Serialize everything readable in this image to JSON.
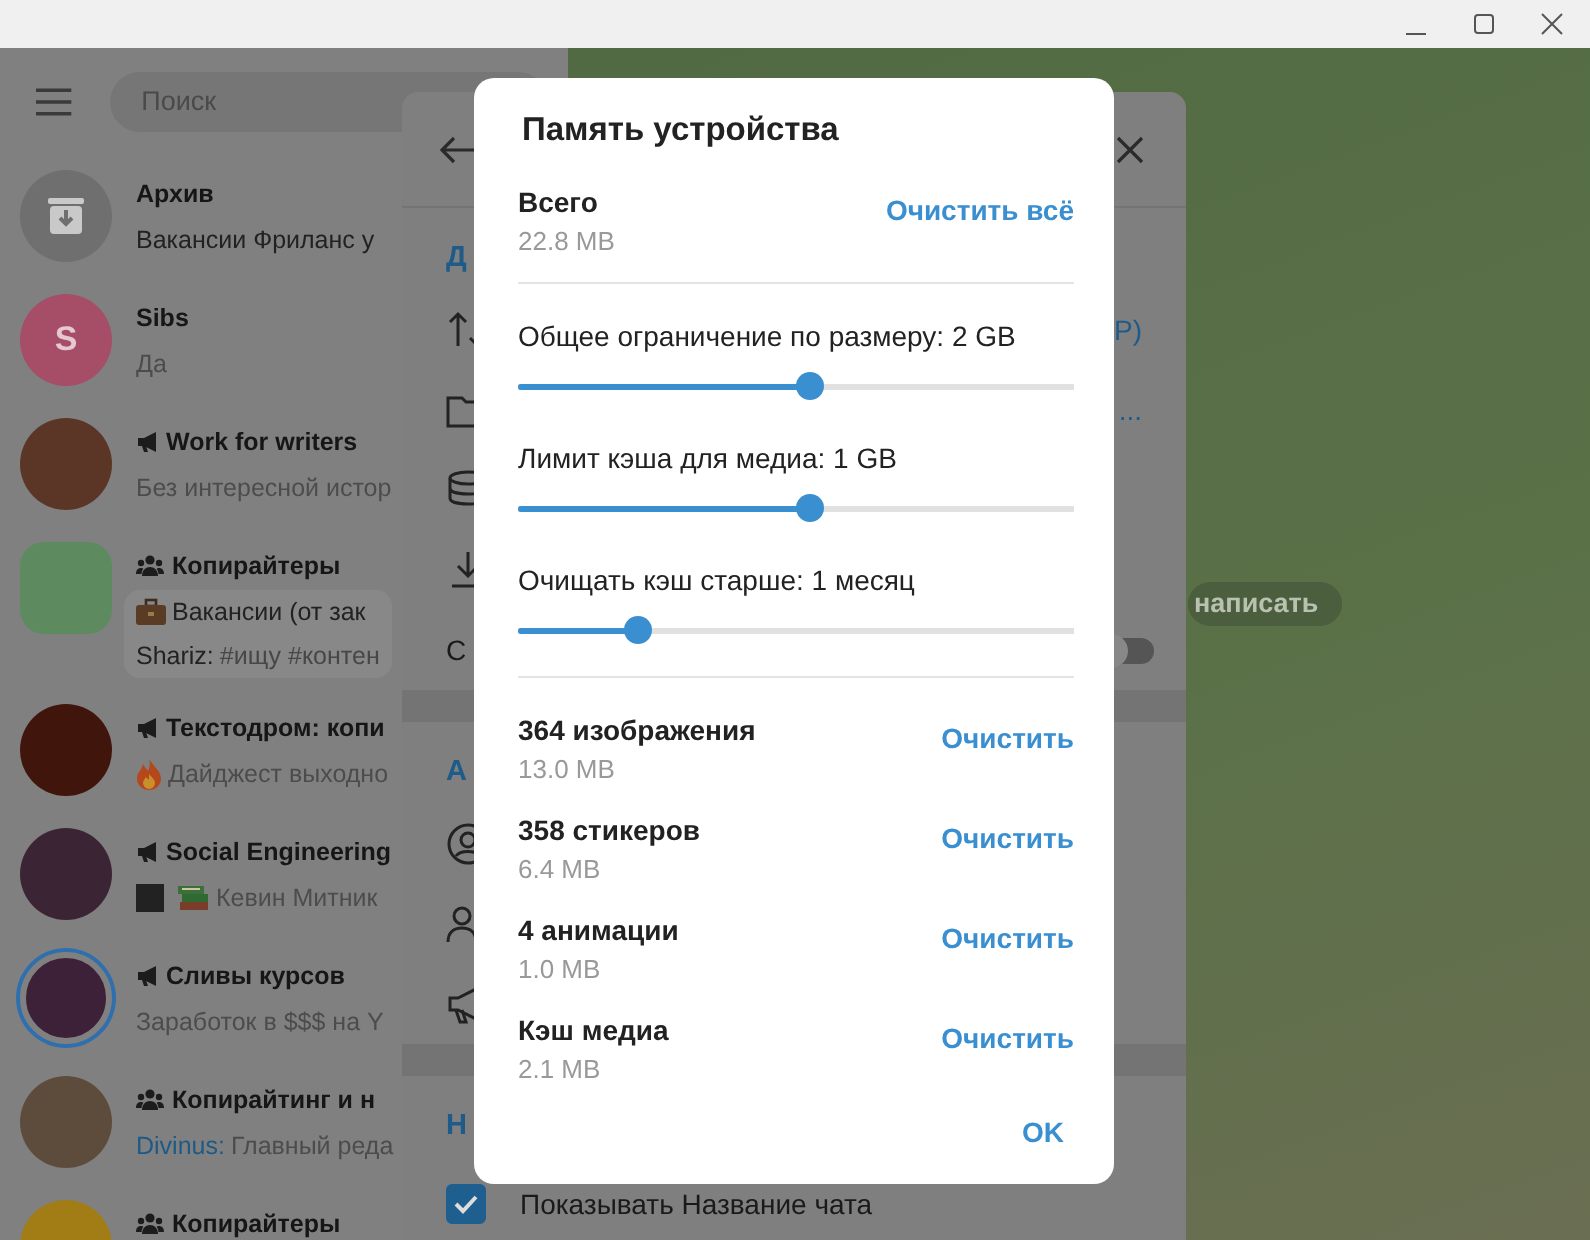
{
  "sidebar": {
    "search": {
      "placeholder": "Поиск"
    },
    "chats": [
      {
        "kind": "archive",
        "color": "#6f6f6f",
        "story": false,
        "title": "Архив",
        "preview": [
          {
            "text": "Вакансии Фриланс у"
          }
        ]
      },
      {
        "kind": "user",
        "color": "#a64d67",
        "story": false,
        "letter": "S",
        "title": "Sibs",
        "preview": [
          {
            "text": "Да"
          }
        ]
      },
      {
        "kind": "channel",
        "color": "#5b3626",
        "story": false,
        "title": "Work for writers",
        "preview": [
          {
            "text": "Без интересной истор"
          }
        ]
      },
      {
        "kind": "forum",
        "color": "#5e8a5f",
        "story": false,
        "title": "Копирайтеры",
        "preview": [
          {
            "icons": [
              {
                "kind": "briefcase"
              }
            ],
            "text": "Вакансии (от зак"
          },
          {
            "sender": "Shariz:",
            "text": "#ищу #контен"
          }
        ]
      },
      {
        "kind": "channel",
        "color": "#40150c",
        "story": false,
        "title": "Текстодром: копи",
        "preview": [
          {
            "icons": [
              {
                "kind": "fire"
              }
            ],
            "text": "Дайджест выходно"
          }
        ]
      },
      {
        "kind": "channel",
        "color": "#3b2535",
        "story": false,
        "title": "Social Engineering",
        "preview": [
          {
            "icons": [
              {
                "kind": "photo"
              },
              {
                "kind": "books"
              }
            ],
            "text": "Кевин Митник"
          }
        ]
      },
      {
        "kind": "channel",
        "color": "#3d2138",
        "story": true,
        "title": "Сливы курсов",
        "preview": [
          {
            "text": "Заработок в $$$ на Y"
          }
        ]
      },
      {
        "kind": "group",
        "color": "#5d4c3b",
        "story": false,
        "title": "Копирайтинг и н",
        "preview": [
          {
            "sender": "Divinus:",
            "text": "Главный реда"
          }
        ]
      },
      {
        "kind": "group",
        "color": "#a27c14",
        "story": false,
        "title": "Копирайтеры"
      }
    ]
  },
  "chat": {
    "button": "написать"
  },
  "settings_panel": {
    "sections": [
      {
        "title": "Д",
        "rows": [
          {
            "kind": "arrows",
            "value": "Р)"
          },
          {
            "kind": "folder",
            "value": "..."
          },
          {
            "kind": "stack"
          },
          {
            "kind": "download"
          },
          {
            "kind": "toggle",
            "label": "С",
            "toggle": false
          }
        ]
      },
      {
        "title": "А",
        "rows": [
          {
            "kind": "person-circle"
          },
          {
            "kind": "people"
          },
          {
            "kind": "megaphone"
          }
        ]
      },
      {
        "title": "Н",
        "rows": [
          {
            "kind": "checkbox",
            "label": "Показывать Название чата",
            "checked": true
          }
        ]
      }
    ]
  },
  "dialog": {
    "title": "Память устройства",
    "total": {
      "label": "Всего",
      "size": "22.8 MB",
      "action": "Очистить всё"
    },
    "sliders": [
      {
        "label": "Общее ограничение по размеру: 2 GB",
        "level": 0.525
      },
      {
        "label": "Лимит кэша для медиа: 1 GB",
        "level": 0.525
      },
      {
        "label": "Очищать кэш старше: 1 месяц",
        "level": 0.216
      }
    ],
    "items": [
      {
        "label": "364 изображения",
        "size": "13.0 MB",
        "action": "Очистить"
      },
      {
        "label": "358 стикеров",
        "size": "6.4 MB",
        "action": "Очистить"
      },
      {
        "label": "4 анимации",
        "size": "1.0 MB",
        "action": "Очистить"
      },
      {
        "label": "Кэш медиа",
        "size": "2.1 MB",
        "action": "Очистить"
      }
    ],
    "ok": "OK"
  }
}
